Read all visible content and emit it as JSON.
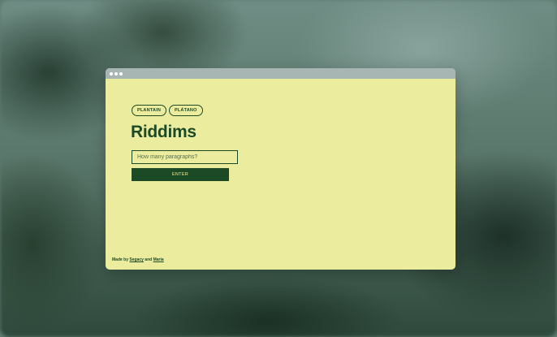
{
  "window": {
    "controls": [
      "dot",
      "dot",
      "dot"
    ]
  },
  "tags": [
    {
      "label": "PLANTAIN"
    },
    {
      "label": "PLÁTANO"
    }
  ],
  "title": "Riddims",
  "form": {
    "placeholder": "How many paragraphs?",
    "value": "",
    "button_label": "ENTER"
  },
  "credit": {
    "prefix": "Made by ",
    "link1": "Segacy",
    "middle": " and ",
    "link2": "Maria"
  },
  "colors": {
    "page_background": "#ecec9f",
    "accent": "#1d4a26",
    "titlebar": "#a7b6b3"
  }
}
